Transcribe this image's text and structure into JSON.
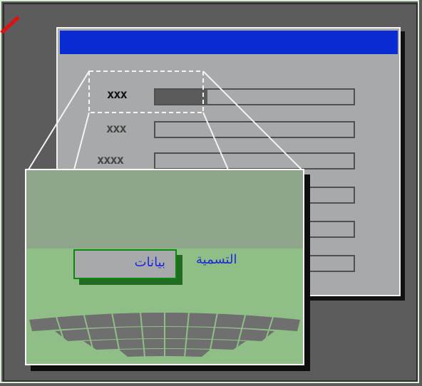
{
  "form": {
    "labels": [
      "xxx",
      "xxx",
      "xxxx"
    ]
  },
  "inset": {
    "caption": "التسمية",
    "field_value": "بيانات"
  },
  "colors": {
    "titlebar": "#0a2bd2",
    "text_accent": "#1a2bd8",
    "highlight_border": "#0a8a0a"
  },
  "icons": [
    "world-map-graphic",
    "red-mark"
  ]
}
